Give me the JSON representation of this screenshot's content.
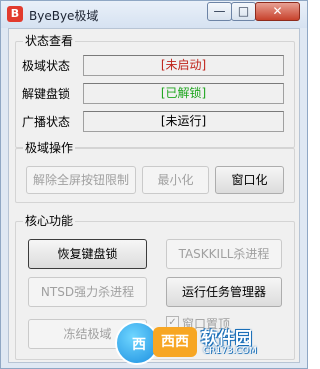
{
  "window": {
    "title": "ByeBye极域",
    "icon_char": "B",
    "minimize_glyph": "—",
    "maximize_glyph": "□",
    "close_glyph": "✕"
  },
  "status_group": {
    "title": "状态查看",
    "rows": [
      {
        "label": "极域状态",
        "value": "[未启动]",
        "color": "#c0251c"
      },
      {
        "label": "解键盘锁",
        "value": "[已解锁]",
        "color": "#1fa61f"
      },
      {
        "label": "广播状态",
        "value": "[未运行]",
        "color": "#000000"
      }
    ]
  },
  "ops_group": {
    "title": "极域操作",
    "unlock_fullscreen": "解除全屏按钮限制",
    "minimize": "最小化",
    "windowed": "窗口化"
  },
  "core_group": {
    "title": "核心功能",
    "restore_keyboard": "恢复键盘锁",
    "taskkill": "TASKKILL杀进程",
    "ntsd_kill": "NTSD强力杀进程",
    "run_taskmgr": "运行任务管理器",
    "freeze": "冻结极域",
    "window_topmost": "窗口置顶"
  },
  "watermark": {
    "circle_text": "西",
    "badge_text": "西西",
    "name": "软件园",
    "url": "CR173.COM"
  }
}
